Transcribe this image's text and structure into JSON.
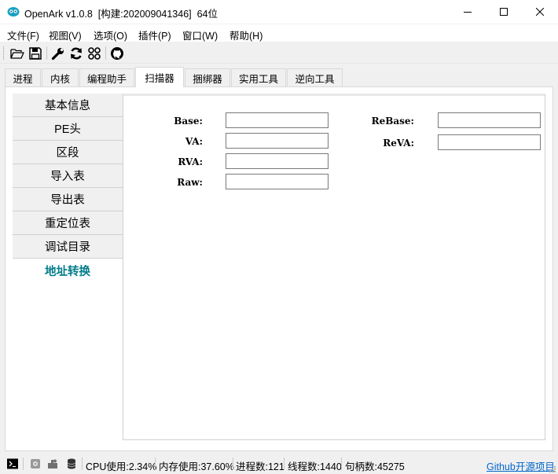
{
  "window": {
    "title": "OpenArk v1.0.8  [构建:202009041346]  64位"
  },
  "menu": [
    {
      "label": "文件(F)"
    },
    {
      "label": "视图(V)"
    },
    {
      "label": "选项(O)"
    },
    {
      "label": "插件(P)"
    },
    {
      "label": "窗口(W)"
    },
    {
      "label": "帮助(H)"
    }
  ],
  "toolbar": {
    "icons": [
      "open-folder-icon",
      "save-icon",
      "wrench-icon",
      "refresh-icon",
      "grid-icon",
      "github-icon"
    ]
  },
  "tabs": [
    {
      "label": "进程"
    },
    {
      "label": "内核"
    },
    {
      "label": "编程助手"
    },
    {
      "label": "扫描器"
    },
    {
      "label": "捆绑器"
    },
    {
      "label": "实用工具"
    },
    {
      "label": "逆向工具"
    }
  ],
  "active_tab": "扫描器",
  "sidebar": {
    "items": [
      {
        "label": "基本信息"
      },
      {
        "label": "PE头"
      },
      {
        "label": "区段"
      },
      {
        "label": "导入表"
      },
      {
        "label": "导出表"
      },
      {
        "label": "重定位表"
      },
      {
        "label": "调试目录"
      },
      {
        "label": "地址转换"
      }
    ],
    "active": "地址转换"
  },
  "form": {
    "base": {
      "label": "Base:",
      "value": ""
    },
    "va": {
      "label": "VA:",
      "value": ""
    },
    "rva": {
      "label": "RVA:",
      "value": ""
    },
    "raw": {
      "label": "Raw:",
      "value": ""
    },
    "rebase": {
      "label": "ReBase:",
      "value": ""
    },
    "reva": {
      "label": "ReVA:",
      "value": ""
    }
  },
  "status": {
    "cpu": "CPU使用:2.34%",
    "memory": "内存使用:37.60%",
    "processes": "进程数:121",
    "threads": "线程数:1440",
    "handles": "句柄数:45275",
    "github_link": "Github开源项目"
  },
  "colors": {
    "accent_active_sidebar": "#007c88",
    "link": "#0066cc",
    "app_icon": "#17a2c4"
  }
}
